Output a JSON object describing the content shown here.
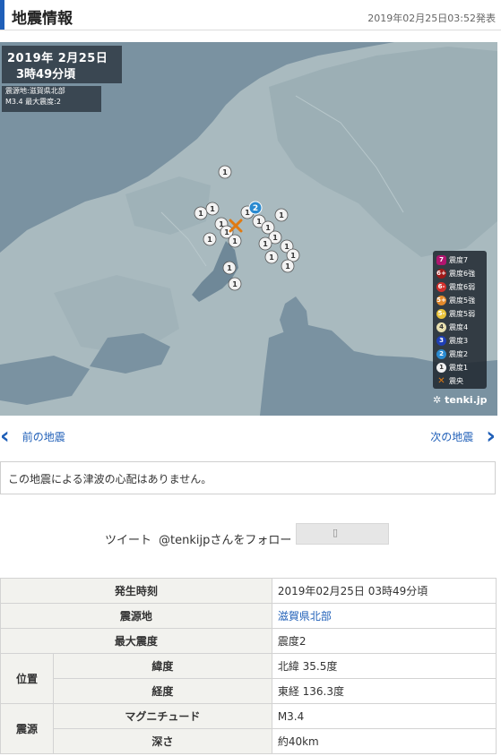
{
  "header": {
    "title": "地震情報",
    "timestamp": "2019年02月25日03:52発表"
  },
  "map": {
    "date": "2019年  2月25日",
    "time": "3時49分頃",
    "info_line1": "震源地:滋賀県北部",
    "info_line2": "M3.4    最大震度:2",
    "legend": [
      {
        "label": "震度7",
        "sym": "7",
        "color": "#b0156f"
      },
      {
        "label": "震度6強",
        "sym": "6+",
        "color": "#a01818"
      },
      {
        "label": "震度6弱",
        "sym": "6-",
        "color": "#d2302c"
      },
      {
        "label": "震度5強",
        "sym": "5+",
        "color": "#e3892b"
      },
      {
        "label": "震度5弱",
        "sym": "5-",
        "color": "#e9c23a"
      },
      {
        "label": "震度4",
        "sym": "4",
        "color": "#e8e0b0"
      },
      {
        "label": "震度3",
        "sym": "3",
        "color": "#1f3fb5"
      },
      {
        "label": "震度2",
        "sym": "2",
        "color": "#2a8ad0"
      },
      {
        "label": "震度1",
        "sym": "1",
        "color": "#f2f2f2"
      },
      {
        "label": "震央",
        "sym": "✕",
        "color": "#e07a12"
      }
    ],
    "brand": "tenki.jp"
  },
  "nav": {
    "prev": "前の地震",
    "next": "次の地震"
  },
  "tsunami_notice": "この地震による津波の心配はありません。",
  "social": {
    "tweet": "ツイート",
    "follow": "@tenkijpさんをフォロー"
  },
  "table": {
    "time_label": "発生時刻",
    "time_value": "2019年02月25日 03時49分頃",
    "epicenter_label": "震源地",
    "epicenter_value": "滋賀県北部",
    "max_label": "最大震度",
    "max_value": "震度2",
    "pos_label": "位置",
    "lat_label": "緯度",
    "lat_value": "北緯 35.5度",
    "lon_label": "経度",
    "lon_value": "東経 136.3度",
    "source_label": "震源",
    "mag_label": "マグニチュード",
    "mag_value": "M3.4",
    "depth_label": "深さ",
    "depth_value": "約40km"
  }
}
